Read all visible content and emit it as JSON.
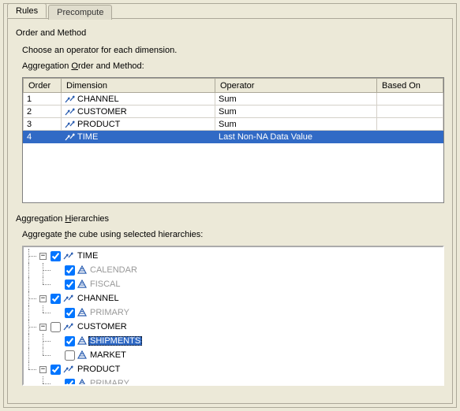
{
  "tabs": {
    "rules": "Rules",
    "precompute": "Precompute"
  },
  "section": {
    "title": "Order and Method",
    "subtitle": "Choose an operator for each dimension.",
    "table_label_pre": "Aggregation ",
    "table_label_u": "O",
    "table_label_post": "rder and Method:"
  },
  "table": {
    "headers": {
      "order": "Order",
      "dimension": "Dimension",
      "operator": "Operator",
      "based_on": "Based On"
    },
    "rows": [
      {
        "order": "1",
        "dimension": "CHANNEL",
        "operator": "Sum",
        "based_on": "",
        "selected": false
      },
      {
        "order": "2",
        "dimension": "CUSTOMER",
        "operator": "Sum",
        "based_on": "",
        "selected": false
      },
      {
        "order": "3",
        "dimension": "PRODUCT",
        "operator": "Sum",
        "based_on": "",
        "selected": false
      },
      {
        "order": "4",
        "dimension": "TIME",
        "operator": "Last Non-NA Data Value",
        "based_on": "",
        "selected": true
      }
    ]
  },
  "hier": {
    "title_pre": "Aggregation ",
    "title_u": "H",
    "title_post": "ierarchies",
    "subtitle_pre": "Aggregate ",
    "subtitle_u": "t",
    "subtitle_post": "he cube using selected hierarchies:"
  },
  "tree": [
    {
      "label": "TIME",
      "checked": true,
      "icon": "dim",
      "children": [
        {
          "label": "CALENDAR",
          "checked": true,
          "disabled": true,
          "icon": "hier"
        },
        {
          "label": "FISCAL",
          "checked": true,
          "disabled": true,
          "icon": "hier"
        }
      ]
    },
    {
      "label": "CHANNEL",
      "checked": true,
      "icon": "dim",
      "children": [
        {
          "label": "PRIMARY",
          "checked": true,
          "disabled": true,
          "icon": "hier"
        }
      ]
    },
    {
      "label": "CUSTOMER",
      "checked": false,
      "icon": "dim",
      "children": [
        {
          "label": "SHIPMENTS",
          "checked": true,
          "disabled": false,
          "icon": "hier",
          "highlight": true
        },
        {
          "label": "MARKET",
          "checked": false,
          "disabled": false,
          "icon": "hier"
        }
      ]
    },
    {
      "label": "PRODUCT",
      "checked": true,
      "icon": "dim",
      "children": [
        {
          "label": "PRIMARY",
          "checked": true,
          "disabled": true,
          "icon": "hier"
        }
      ]
    }
  ]
}
